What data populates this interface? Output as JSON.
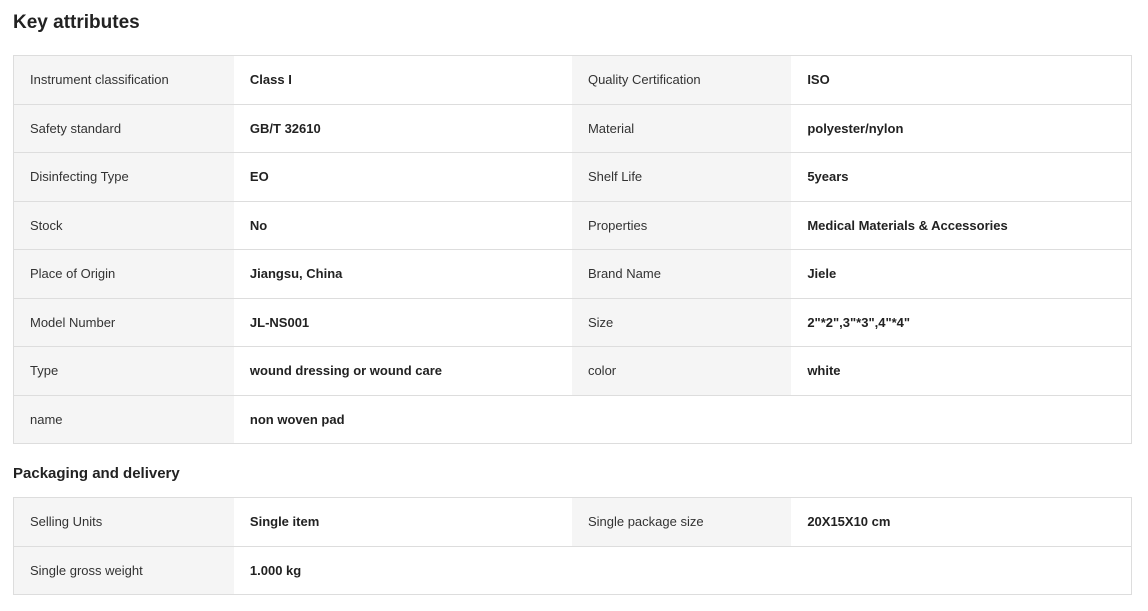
{
  "key_attributes": {
    "title": "Key attributes",
    "rows": [
      [
        {
          "label": "Instrument classification",
          "value": "Class I"
        },
        {
          "label": "Quality Certification",
          "value": "ISO"
        }
      ],
      [
        {
          "label": "Safety standard",
          "value": "GB/T 32610"
        },
        {
          "label": "Material",
          "value": "polyester/nylon"
        }
      ],
      [
        {
          "label": "Disinfecting Type",
          "value": "EO"
        },
        {
          "label": "Shelf Life",
          "value": "5years"
        }
      ],
      [
        {
          "label": "Stock",
          "value": "No"
        },
        {
          "label": "Properties",
          "value": "Medical Materials & Accessories"
        }
      ],
      [
        {
          "label": "Place of Origin",
          "value": "Jiangsu, China"
        },
        {
          "label": "Brand Name",
          "value": "Jiele"
        }
      ],
      [
        {
          "label": "Model Number",
          "value": "JL-NS001"
        },
        {
          "label": "Size",
          "value": "2\"*2\",3\"*3\",4\"*4\""
        }
      ],
      [
        {
          "label": "Type",
          "value": "wound dressing or wound care"
        },
        {
          "label": "color",
          "value": "white"
        }
      ],
      [
        {
          "label": "name",
          "value": "non woven pad"
        }
      ]
    ]
  },
  "packaging": {
    "title": "Packaging and delivery",
    "rows": [
      [
        {
          "label": "Selling Units",
          "value": "Single item"
        },
        {
          "label": "Single package size",
          "value": "20X15X10 cm"
        }
      ],
      [
        {
          "label": "Single gross weight",
          "value": "1.000 kg"
        }
      ]
    ]
  }
}
